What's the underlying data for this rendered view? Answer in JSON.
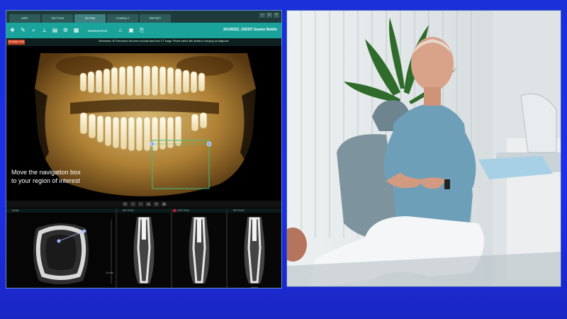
{
  "app": {
    "tabs": [
      {
        "label": "MPR",
        "active": false
      },
      {
        "label": "SECTION",
        "active": false
      },
      {
        "label": "3D PAN",
        "active": true
      },
      {
        "label": "CONSULT",
        "active": false
      },
      {
        "label": "REPORT",
        "active": false
      }
    ],
    "toolbar": {
      "tools": [
        {
          "icon": "pan-icon"
        },
        {
          "icon": "brush-icon"
        },
        {
          "icon": "zoom-icon"
        },
        {
          "icon": "measure-icon"
        },
        {
          "icon": "print-icon"
        },
        {
          "icon": "settings-icon"
        },
        {
          "icon": "grid-icon"
        }
      ],
      "measurement_label": "Measurement",
      "right_text": "20140322_100337  Esame  Nobile"
    },
    "mode_badge": "3D ANALYSIS",
    "info_text": "Information: 3D Panoramic has been reconstructed from CT image. Please select with dentist or carrying out diagnosis",
    "pano_caption_line1": "Move the navigation box",
    "pano_caption_line2": "to your region of interest",
    "slice_panels": [
      {
        "label": "AXIAL"
      },
      {
        "label": "SECTION"
      },
      {
        "label": "SECTION"
      },
      {
        "label": "SECTION"
      }
    ],
    "scale_label": "10 mm"
  },
  "colors": {
    "background": "#1f2fe6",
    "toolbar": "#1aa39b",
    "navigation_box": "#3fbf7f",
    "bone": "#c79a4a"
  }
}
